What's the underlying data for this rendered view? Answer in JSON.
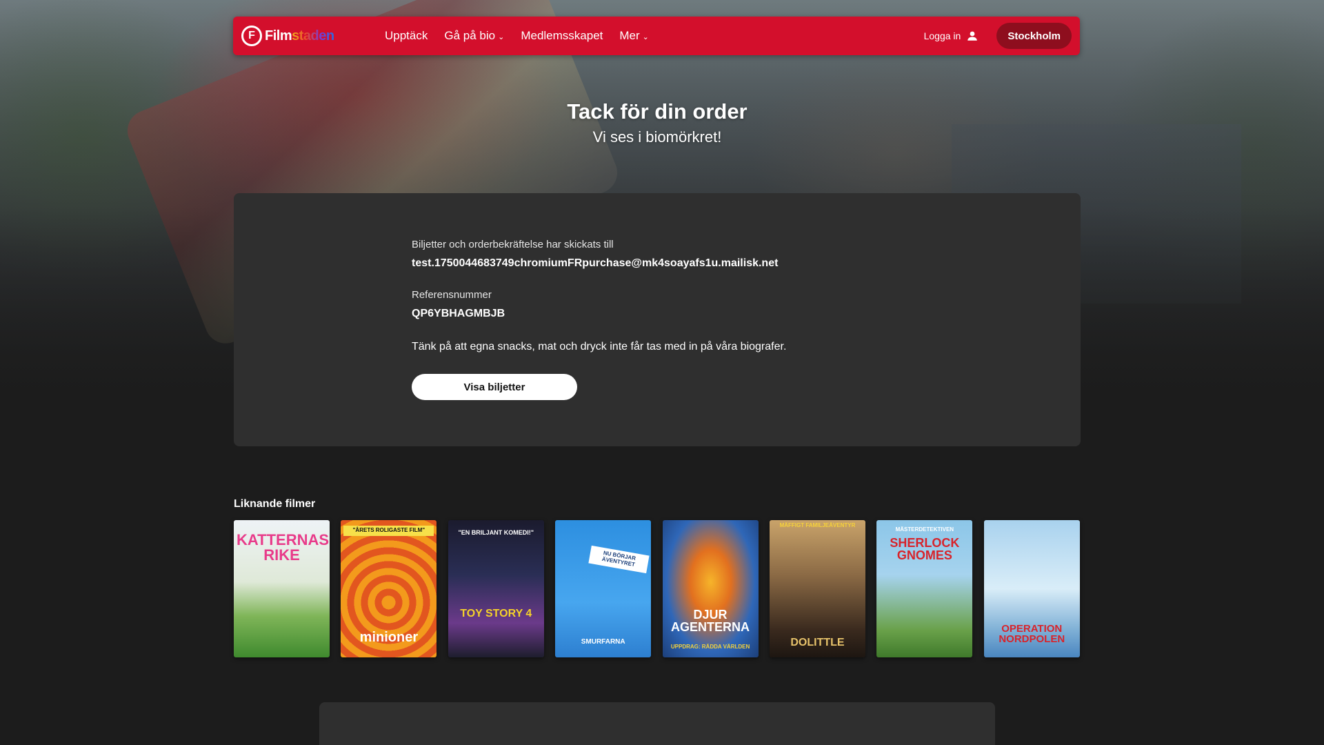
{
  "nav": {
    "logo_badge": "F",
    "logo_prefix": "Film",
    "logo_rainbow": "staden",
    "links": [
      {
        "label": "Upptäck",
        "has_dropdown": false
      },
      {
        "label": "Gå på bio",
        "has_dropdown": true
      },
      {
        "label": "Medlemsskapet",
        "has_dropdown": false
      },
      {
        "label": "Mer",
        "has_dropdown": true
      }
    ],
    "login_label": "Logga in",
    "city_label": "Stockholm",
    "brand_color": "#d30f2c"
  },
  "hero": {
    "title": "Tack för din order",
    "subtitle": "Vi ses i biomörkret!"
  },
  "order": {
    "sent_to_label": "Biljetter och orderbekräftelse har skickats till",
    "email": "test.1750044683749chromiumFRpurchase@mk4soayafs1u.mailisk.net",
    "reference_label": "Referensnummer",
    "reference": "QP6YBHAGMBJB",
    "note": "Tänk på att egna snacks, mat och dryck inte får tas med in på våra biografer.",
    "button_label": "Visa biljetter"
  },
  "similar": {
    "heading": "Liknande filmer",
    "posters": [
      {
        "title": "KATTERNAS RIKE",
        "sub": "",
        "color": "#e83b8a"
      },
      {
        "title": "minioner",
        "sub": "\"ÅRETS ROLIGASTE FILM\"",
        "color": "#ffffff"
      },
      {
        "title": "TOY STORY 4",
        "sub": "\"EN BRILJANT KOMEDI!\"",
        "color": "#f5d12a"
      },
      {
        "title": "SMURFARNA",
        "sub": "NU BÖRJAR ÄVENTYRET",
        "color": "#ffffff"
      },
      {
        "title": "DJUR AGENTERNA",
        "sub": "UPPDRAG: RÄDDA VÄRLDEN",
        "color": "#ffffff"
      },
      {
        "title": "DOLITTLE",
        "sub": "MÄFFIGT FAMILJEÄVENTYR",
        "color": "#e7c36b"
      },
      {
        "title": "SHERLOCK GNOMES",
        "sub": "MÄSTERDETEKTIVEN",
        "color": "#d8232a"
      },
      {
        "title": "OPERATION NORDPOLEN",
        "sub": "",
        "color": "#d8232a"
      }
    ]
  }
}
